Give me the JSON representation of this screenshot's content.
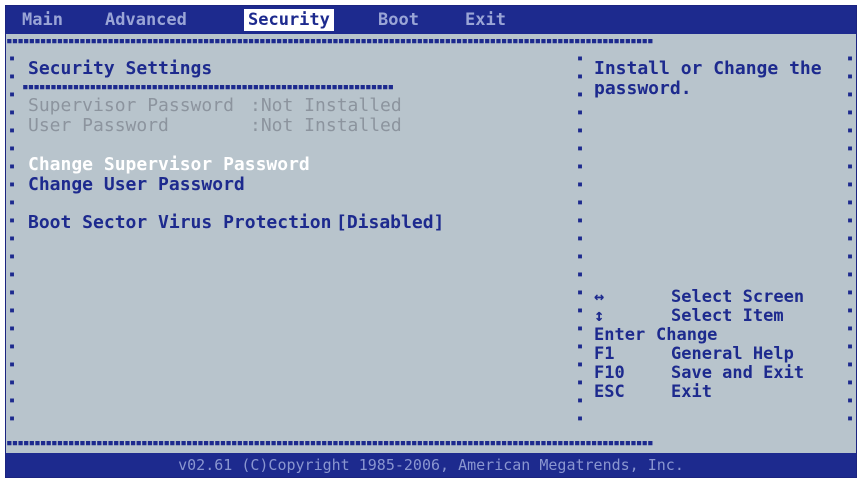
{
  "menubar": {
    "items": [
      "Main",
      "Advanced",
      "Security",
      "Boot",
      "Exit"
    ],
    "active": "Security"
  },
  "main": {
    "title": "Security Settings",
    "supervisor_password_label": "Supervisor Password",
    "supervisor_password_value": ":Not Installed",
    "user_password_label": "User Password",
    "user_password_value": ":Not Installed",
    "change_supervisor_password": "Change Supervisor Password",
    "change_user_password": "Change User Password",
    "boot_sector_virus_label": "Boot Sector Virus Protection",
    "boot_sector_virus_value": "[Disabled]"
  },
  "help": {
    "line1": "Install or Change the",
    "line2": "password.",
    "keys": [
      {
        "key": "↔",
        "action": "Select Screen"
      },
      {
        "key": "↕",
        "action": "Select Item"
      },
      {
        "key": "Enter",
        "action": "Change"
      },
      {
        "key": "F1",
        "action": "General Help"
      },
      {
        "key": "F10",
        "action": "Save and Exit"
      },
      {
        "key": "ESC",
        "action": "Exit"
      }
    ]
  },
  "footer": {
    "copyright": "v02.61 (C)Copyright 1985-2006, American Megatrends, Inc."
  },
  "colors": {
    "background": "#b8c4cc",
    "accent": "#1d2a8e",
    "highlight": "#ffffff",
    "disabled_text": "#8c949e"
  }
}
